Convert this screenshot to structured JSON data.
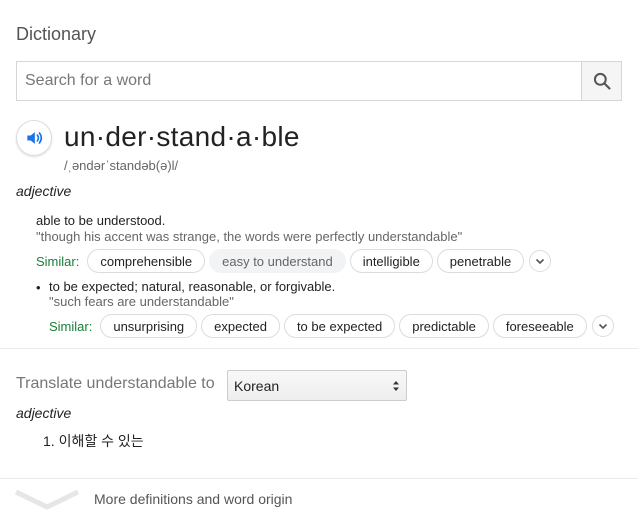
{
  "panel": {
    "title": "Dictionary"
  },
  "search": {
    "placeholder": "Search for a word",
    "value": ""
  },
  "entry": {
    "headword": "un·der·stand·a·ble",
    "pronunciation": "/ˌəndərˈstandəb(ə)l/",
    "part_of_speech": "adjective",
    "senses": [
      {
        "definition": "able to be understood.",
        "example": "\"though his accent was strange, the words were perfectly understandable\"",
        "similar_label": "Similar:",
        "similar": [
          "comprehensible",
          "easy to understand",
          "intelligible",
          "penetrable"
        ]
      },
      {
        "bullet": "•",
        "definition": "to be expected; natural, reasonable, or forgivable.",
        "example": "\"such fears are understandable\"",
        "similar_label": "Similar:",
        "similar": [
          "unsurprising",
          "expected",
          "to be expected",
          "predictable",
          "foreseeable"
        ]
      }
    ]
  },
  "translate": {
    "label": "Translate understandable to",
    "language": "Korean",
    "part_of_speech": "adjective",
    "results": [
      "1. 이해할 수 있는"
    ]
  },
  "footer": {
    "more_label": "More definitions and word origin"
  },
  "colors": {
    "accent_blue": "#1a73e8",
    "similar_green": "#188038",
    "chip_border": "#dadce0"
  },
  "icons": {
    "search": "search-icon",
    "audio": "speaker-icon",
    "expand": "chevron-down-icon",
    "more": "chevron-down-icon"
  }
}
